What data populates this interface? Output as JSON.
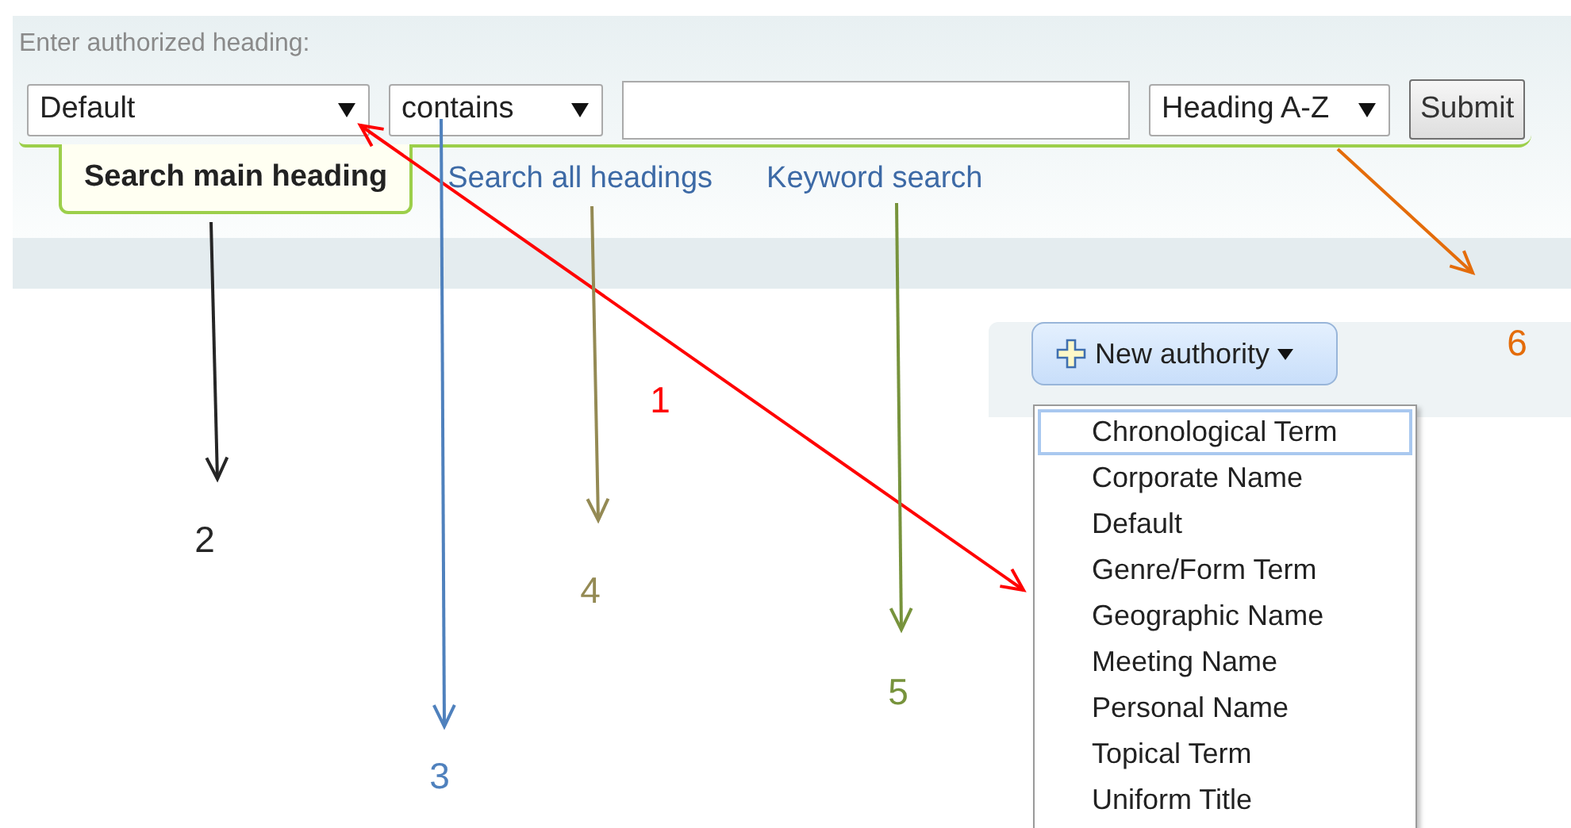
{
  "search_panel": {
    "prompt": "Enter authorized heading:",
    "heading_type": "Default",
    "match": "contains",
    "sort": "Heading A-Z",
    "submit": "Submit"
  },
  "tabs": [
    {
      "label": "Search main heading",
      "selected": true
    },
    {
      "label": "Search all headings",
      "selected": false
    },
    {
      "label": "Keyword search",
      "selected": false
    }
  ],
  "new_authority": {
    "label": "New authority",
    "menu": [
      {
        "label": "Chronological Term",
        "selected": true
      },
      {
        "label": "Corporate Name",
        "selected": false
      },
      {
        "label": "Default",
        "selected": false
      },
      {
        "label": "Genre/Form Term",
        "selected": false
      },
      {
        "label": "Geographic Name",
        "selected": false
      },
      {
        "label": "Meeting Name",
        "selected": false
      },
      {
        "label": "Personal Name",
        "selected": false
      },
      {
        "label": "Topical Term",
        "selected": false
      },
      {
        "label": "Uniform Title",
        "selected": false
      }
    ]
  },
  "annotations": [
    {
      "label": "1",
      "color": "#ff0000",
      "kind": "double"
    },
    {
      "label": "2",
      "color": "#262626",
      "kind": "single"
    },
    {
      "label": "3",
      "color": "#4f81bd",
      "kind": "single"
    },
    {
      "label": "4",
      "color": "#948a54",
      "kind": "single"
    },
    {
      "label": "5",
      "color": "#77933c",
      "kind": "single"
    },
    {
      "label": "6",
      "color": "#e46c0a",
      "kind": "single"
    }
  ]
}
